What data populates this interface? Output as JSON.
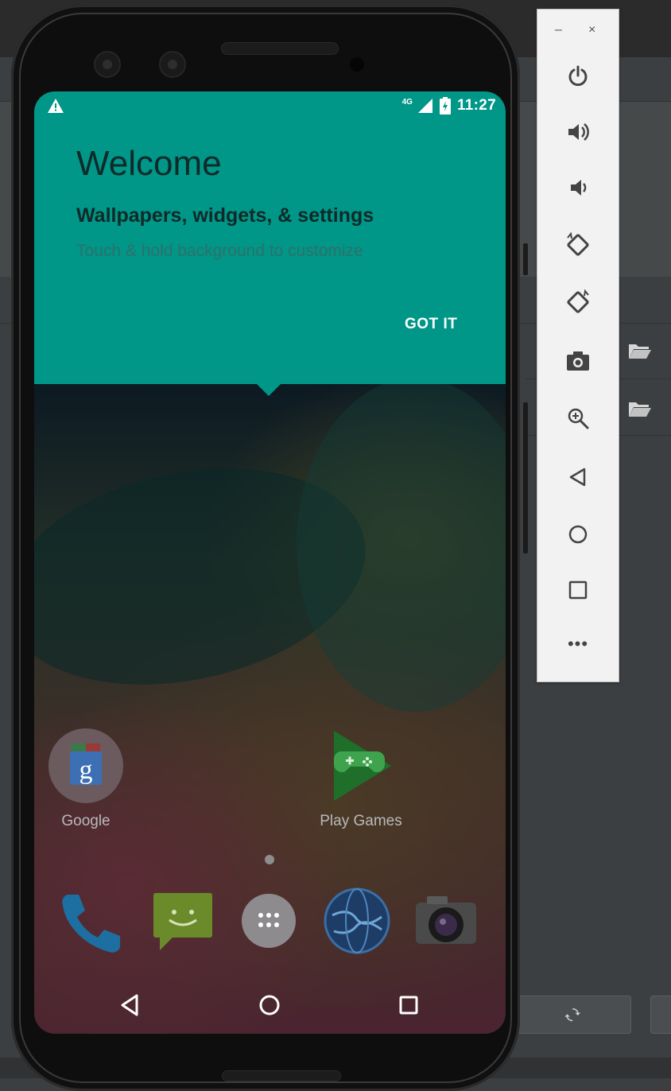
{
  "statusbar": {
    "network": "4G",
    "time": "11:27"
  },
  "welcome": {
    "title": "Welcome",
    "subtitle": "Wallpapers, widgets, & settings",
    "hint": "Touch & hold background to customize",
    "action": "GOT IT"
  },
  "home_apps": [
    {
      "label": "Google",
      "icon": "google-folder-icon"
    },
    {
      "label": "Play Games",
      "icon": "play-games-icon"
    }
  ],
  "dock": [
    "phone-icon",
    "messaging-icon",
    "app-drawer-icon",
    "browser-icon",
    "camera-icon"
  ],
  "navbar": [
    "back-icon",
    "home-icon",
    "recents-icon"
  ],
  "emulator_controls": {
    "minimize": "–",
    "close": "×",
    "more": "•••",
    "buttons": [
      "power-icon",
      "volume-up-icon",
      "volume-down-icon",
      "rotate-left-icon",
      "rotate-right-icon",
      "screenshot-icon",
      "zoom-icon",
      "back-icon",
      "home-icon",
      "overview-icon",
      "more-icon"
    ]
  },
  "colors": {
    "welcome_card": "#009688",
    "ide_background": "#3c3f41",
    "emulator_panel": "#f2f2f2"
  }
}
